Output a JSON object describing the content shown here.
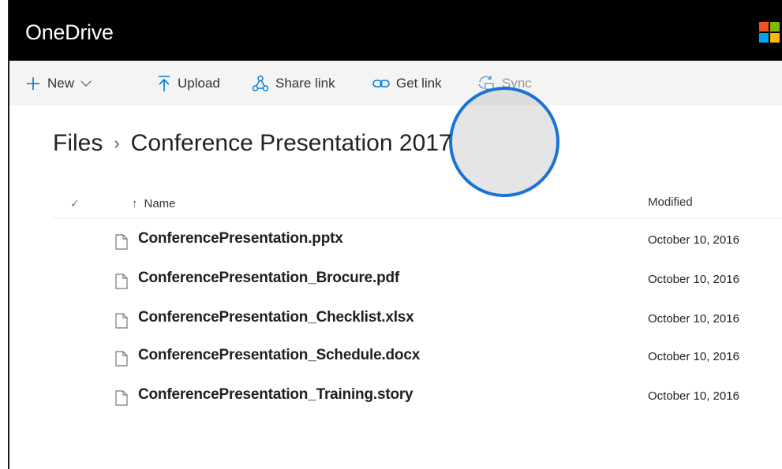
{
  "app": {
    "title": "OneDrive"
  },
  "brand": {
    "logo_colors": [
      "#f25022",
      "#7fba00",
      "#00a4ef",
      "#ffb900"
    ]
  },
  "toolbar": {
    "new_label": "New",
    "upload_label": "Upload",
    "share_link_label": "Share link",
    "get_link_label": "Get link",
    "sync_label": "Sync",
    "sync_state": "disabled",
    "highlight_color": "#1b73d3"
  },
  "breadcrumb": {
    "root": "Files",
    "separator": "›",
    "current": "Conference Presentation 2017"
  },
  "list": {
    "check_symbol": "✓",
    "sort_arrow": "↑",
    "columns": {
      "name": "Name",
      "modified": "Modified"
    },
    "rows": [
      {
        "name": "ConferencePresentation.pptx",
        "modified": "October 10, 2016",
        "icon": "file-icon"
      },
      {
        "name": "ConferencePresentation_Brocure.pdf",
        "modified": "October 10, 2016",
        "icon": "file-icon"
      },
      {
        "name": "ConferencePresentation_Checklist.xlsx",
        "modified": "October 10, 2016",
        "icon": "file-icon"
      },
      {
        "name": "ConferencePresentation_Schedule.docx",
        "modified": "October 10, 2016",
        "icon": "file-icon"
      },
      {
        "name": "ConferencePresentation_Training.story",
        "modified": "October 10, 2016",
        "icon": "file-icon"
      }
    ]
  }
}
